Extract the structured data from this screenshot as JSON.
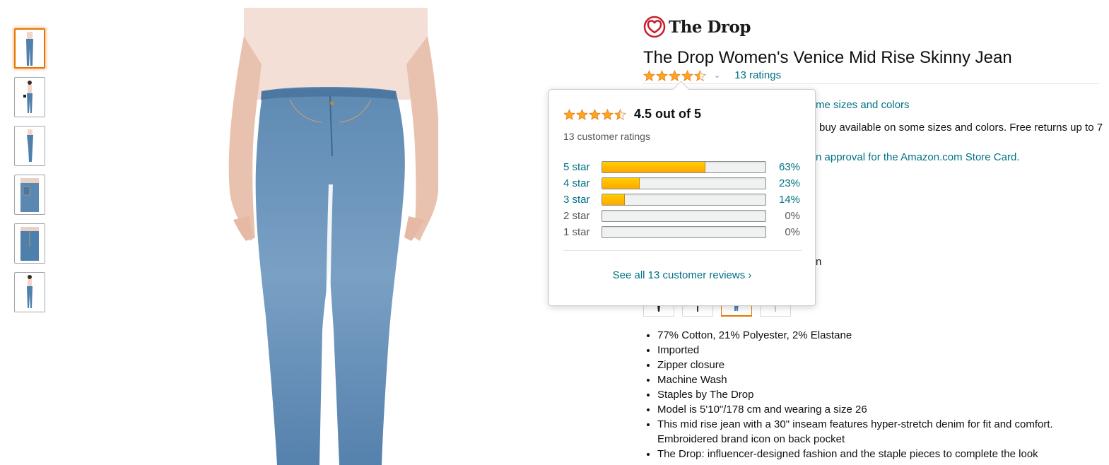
{
  "brand": {
    "name": "The Drop",
    "logo_icon": "heart-logo-icon",
    "color": "#c7202c"
  },
  "product": {
    "title": "The Drop Women's Venice Mid Rise Skinny Jean",
    "rating_value": 4.5,
    "ratings_link": "13 ratings"
  },
  "partial_text": {
    "sizes_colors": "me sizes and colors",
    "returns": "buy available on some sizes and colors. Free returns up to 7",
    "card": "n approval for the Amazon.com Store Card.",
    "misc": "n"
  },
  "popover": {
    "rating_text": "4.5 out of 5",
    "count_text": "13 customer ratings",
    "histogram": [
      {
        "label": "5 star",
        "percent": 63,
        "percent_text": "63%"
      },
      {
        "label": "4 star",
        "percent": 23,
        "percent_text": "23%"
      },
      {
        "label": "3 star",
        "percent": 14,
        "percent_text": "14%"
      },
      {
        "label": "2 star",
        "percent": 0,
        "percent_text": "0%"
      },
      {
        "label": "1 star",
        "percent": 0,
        "percent_text": "0%"
      }
    ],
    "see_all": "See all 13 customer reviews ›"
  },
  "bullets": [
    "77% Cotton, 21% Polyester, 2% Elastane",
    "Imported",
    "Zipper closure",
    "Machine Wash",
    "Staples by The Drop",
    "Model is 5'10\"/178 cm and wearing a size 26",
    "This mid rise jean with a 30\" inseam features hyper-stretch denim for fit and comfort. Embroidered brand icon on back pocket",
    "The Drop: influencer-designed fashion and the staple pieces to complete the look"
  ],
  "colors": {
    "link": "#007185",
    "star": "#ffa41c",
    "selected_border": "#e77600",
    "denim": "#4f7fab",
    "skin": "#e3b9a0"
  }
}
